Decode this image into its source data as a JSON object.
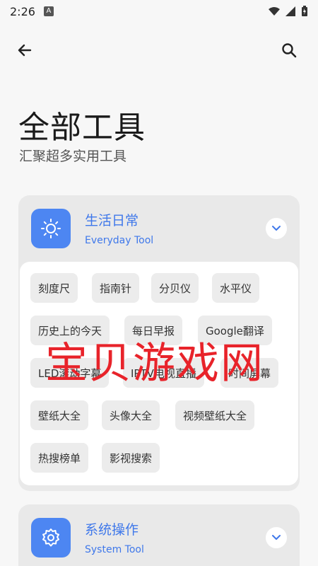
{
  "status_bar": {
    "time": "2:26",
    "notif_letter": "A"
  },
  "page": {
    "title": "全部工具",
    "subtitle": "汇聚超多实用工具"
  },
  "cards": [
    {
      "title": "生活日常",
      "subtitle": "Everyday Tool",
      "chips": [
        "刻度尺",
        "指南针",
        "分贝仪",
        "水平仪",
        "历史上的今天",
        "每日早报",
        "Google翻译",
        "LED滚动字幕",
        "IPTV电视直播",
        "时间屏幕",
        "壁纸大全",
        "头像大全",
        "视频壁纸大全",
        "热搜榜单",
        "影视搜索"
      ]
    },
    {
      "title": "系统操作",
      "subtitle": "System Tool"
    }
  ],
  "watermark": "宝贝游戏网",
  "colors": {
    "accent": "#4d86f2",
    "watermark": "#e8232a"
  }
}
